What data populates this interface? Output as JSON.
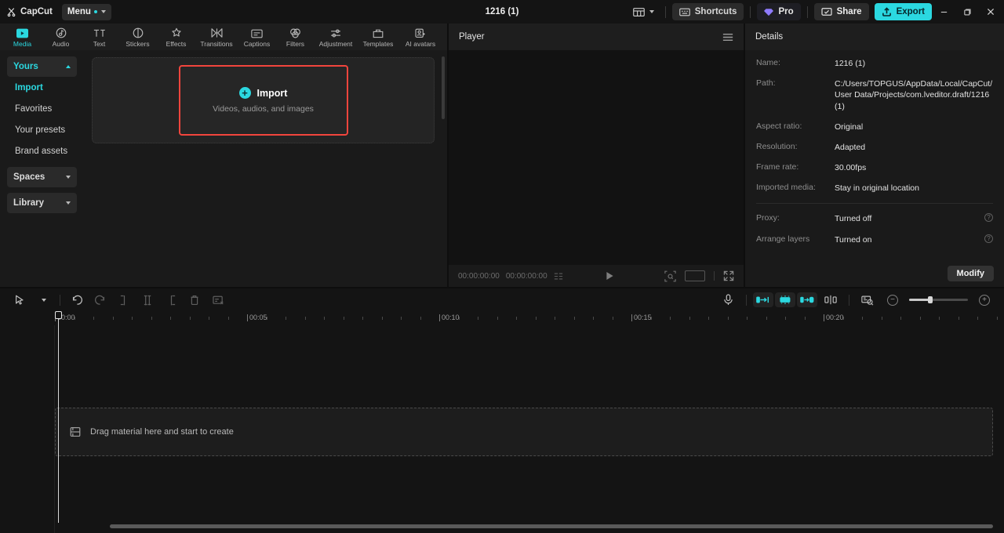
{
  "app": {
    "brand": "CapCut",
    "menu_label": "Menu",
    "project_title": "1216 (1)"
  },
  "titlebar": {
    "layout_icon": "layout-icon",
    "shortcuts_label": "Shortcuts",
    "pro_label": "Pro",
    "share_label": "Share",
    "export_label": "Export",
    "minimize": "minimize-icon",
    "maximize": "maximize-icon",
    "close": "close-icon"
  },
  "tabs": [
    {
      "label": "Media",
      "icon": "media-icon",
      "active": true
    },
    {
      "label": "Audio",
      "icon": "audio-icon",
      "active": false
    },
    {
      "label": "Text",
      "icon": "text-icon",
      "active": false
    },
    {
      "label": "Stickers",
      "icon": "stickers-icon",
      "active": false
    },
    {
      "label": "Effects",
      "icon": "effects-icon",
      "active": false
    },
    {
      "label": "Transitions",
      "icon": "transitions-icon",
      "active": false
    },
    {
      "label": "Captions",
      "icon": "captions-icon",
      "active": false
    },
    {
      "label": "Filters",
      "icon": "filters-icon",
      "active": false
    },
    {
      "label": "Adjustment",
      "icon": "adjustment-icon",
      "active": false
    },
    {
      "label": "Templates",
      "icon": "templates-icon",
      "active": false
    },
    {
      "label": "AI avatars",
      "icon": "ai-avatars-icon",
      "active": false
    }
  ],
  "sidebar": {
    "items": [
      {
        "label": "Yours",
        "type": "group",
        "expanded": true,
        "active": true
      },
      {
        "label": "Import",
        "type": "sub",
        "active": true
      },
      {
        "label": "Favorites",
        "type": "sub",
        "active": false
      },
      {
        "label": "Your presets",
        "type": "sub",
        "active": false
      },
      {
        "label": "Brand assets",
        "type": "sub",
        "active": false
      },
      {
        "label": "Spaces",
        "type": "group",
        "expanded": false,
        "active": false
      },
      {
        "label": "Library",
        "type": "group",
        "expanded": false,
        "active": false
      }
    ]
  },
  "media": {
    "import_label": "Import",
    "import_subtitle": "Videos, audios, and images",
    "highlight_color": "#f2453d"
  },
  "player": {
    "title": "Player",
    "menu_icon": "hamburger-icon",
    "current_time": "00:00:00:00",
    "total_time": "00:00:00:00",
    "play_icon": "play-icon",
    "quality_icon": "quality-icon",
    "ratio_icon": "aspect-ratio-icon",
    "fullscreen_icon": "fullscreen-icon"
  },
  "details": {
    "title": "Details",
    "rows": [
      {
        "key": "Name:",
        "value": "1216 (1)"
      },
      {
        "key": "Path:",
        "value": "C:/Users/TOPGUS/AppData/Local/CapCut/User Data/Projects/com.lveditor.draft/1216 (1)"
      },
      {
        "key": "Aspect ratio:",
        "value": "Original"
      },
      {
        "key": "Resolution:",
        "value": "Adapted"
      },
      {
        "key": "Frame rate:",
        "value": "30.00fps"
      },
      {
        "key": "Imported media:",
        "value": "Stay in original location"
      }
    ],
    "toggle_rows": [
      {
        "key": "Proxy:",
        "value": "Turned off",
        "info": "info-icon"
      },
      {
        "key": "Arrange layers",
        "value": "Turned on",
        "info": "info-icon"
      }
    ],
    "modify_label": "Modify"
  },
  "timeline": {
    "tools": [
      {
        "name": "select-tool",
        "icon": "cursor-icon",
        "dim": false
      },
      {
        "name": "select-dropdown",
        "icon": "chevron-down-icon",
        "dim": false
      },
      {
        "name": "undo-button",
        "icon": "undo-icon",
        "dim": false
      },
      {
        "name": "redo-button",
        "icon": "redo-icon",
        "dim": true
      },
      {
        "name": "split-button",
        "icon": "split-icon",
        "dim": true
      },
      {
        "name": "trim-left-button",
        "icon": "trim-left-icon",
        "dim": true
      },
      {
        "name": "trim-right-button",
        "icon": "trim-right-icon",
        "dim": true
      },
      {
        "name": "delete-button",
        "icon": "trash-icon",
        "dim": true
      },
      {
        "name": "crop-button",
        "icon": "crop-icon",
        "dim": true
      }
    ],
    "right_tools": [
      {
        "name": "record-voiceover-button",
        "icon": "microphone-icon"
      },
      {
        "name": "auto-cut-button",
        "icon": "auto-cut-icon"
      },
      {
        "name": "auto-highlight-button",
        "icon": "auto-highlight-icon"
      },
      {
        "name": "auto-reframe-button",
        "icon": "auto-reframe-icon"
      },
      {
        "name": "split-marker-button",
        "icon": "split-marker-icon"
      },
      {
        "name": "preview-thumbnail-button",
        "icon": "preview-icon"
      }
    ],
    "zoom_out_icon": "zoom-out-icon",
    "zoom_in_icon": "zoom-in-icon",
    "ruler_labels": [
      "00:00",
      "00:05",
      "00:10",
      "00:15",
      "00:20"
    ],
    "ruler_label_positions": [
      0,
      245,
      490,
      735,
      980
    ],
    "tick_spacing": 24.5,
    "tick_count": 50,
    "dropzone_label": "Drag material here and start to create",
    "dropzone_icon": "media-placeholder-icon"
  }
}
